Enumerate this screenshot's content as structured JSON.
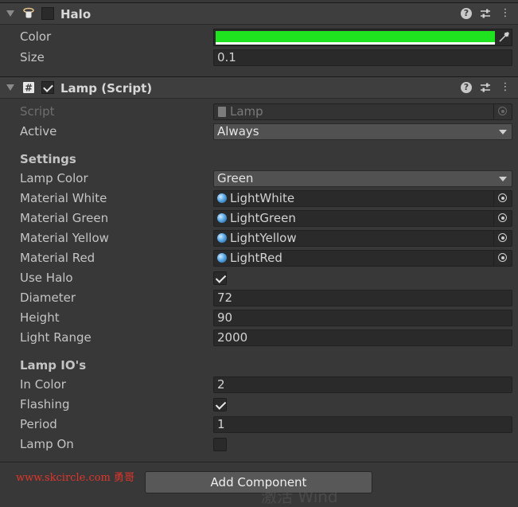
{
  "halo": {
    "title": "Halo",
    "enabled": false,
    "icon": "halo-icon",
    "fields": {
      "color_label": "Color",
      "color_value": "#1ee31e",
      "size_label": "Size",
      "size_value": "0.1"
    }
  },
  "lamp": {
    "title": "Lamp (Script)",
    "enabled": true,
    "icon": "script-hash-icon",
    "script_label": "Script",
    "script_value": "Lamp",
    "active_label": "Active",
    "active_value": "Always",
    "settings_header": "Settings",
    "lamp_color_label": "Lamp Color",
    "lamp_color_value": "Green",
    "materials": [
      {
        "label": "Material White",
        "value": "LightWhite"
      },
      {
        "label": "Material Green",
        "value": "LightGreen"
      },
      {
        "label": "Material Yellow",
        "value": "LightYellow"
      },
      {
        "label": "Material Red",
        "value": "LightRed"
      }
    ],
    "use_halo_label": "Use Halo",
    "use_halo": true,
    "diameter_label": "Diameter",
    "diameter_value": "72",
    "height_label": "Height",
    "height_value": "90",
    "light_range_label": "Light Range",
    "light_range_value": "2000",
    "io_header": "Lamp IO's",
    "in_color_label": "In Color",
    "in_color_value": "2",
    "flashing_label": "Flashing",
    "flashing": true,
    "period_label": "Period",
    "period_value": "1",
    "lamp_on_label": "Lamp On",
    "lamp_on": false
  },
  "footer": {
    "add_component": "Add Component",
    "watermark": "www.skcircle.com 勇哥",
    "ghost_text": "激活 Wind"
  }
}
